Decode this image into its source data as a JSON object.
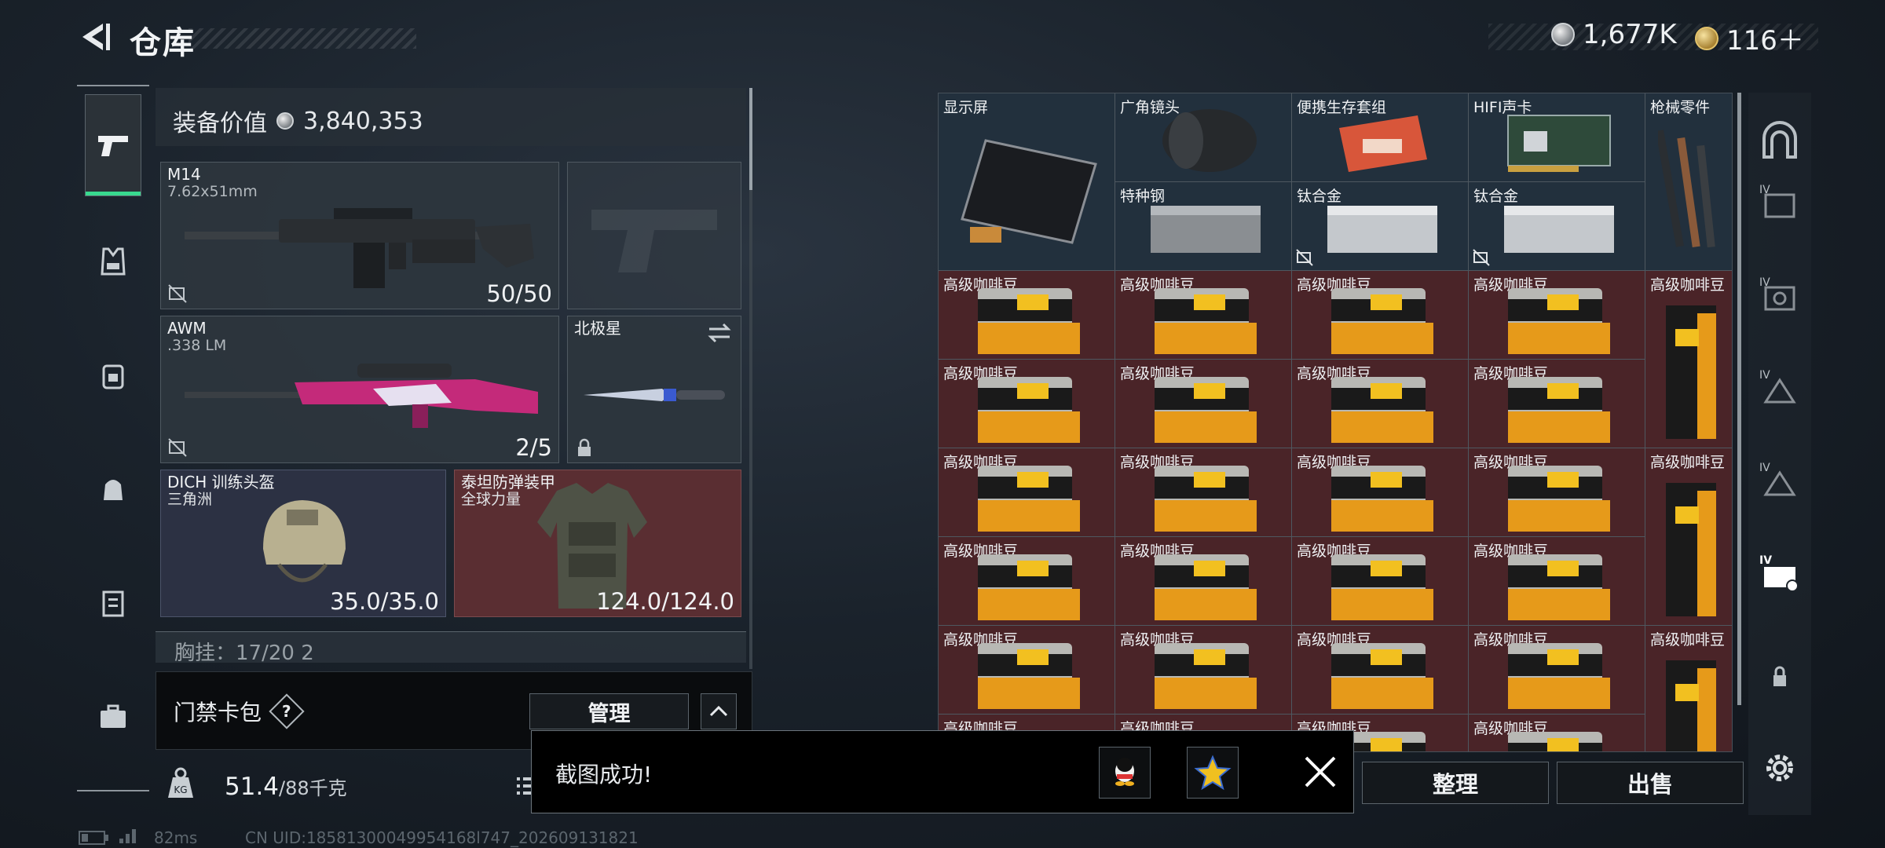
{
  "header": {
    "title": "仓库",
    "currency_silver": "1,677K",
    "currency_gold": "116＋"
  },
  "nav": [
    "weapons-icon",
    "vest-icon",
    "backpack-icon",
    "bag-icon",
    "clipboard-icon",
    "briefcase-icon"
  ],
  "equipment": {
    "value_label": "装备价值",
    "value": "3,840,353",
    "slots": {
      "primary1": {
        "name": "M14",
        "ammo": "7.62x51mm",
        "count": "50/50"
      },
      "primary2": {
        "name": "AWM",
        "ammo": ".338 LM",
        "count": "2/5"
      },
      "melee": {
        "name": "北极星"
      },
      "helmet": {
        "name": "DICH 训练头盔",
        "brand": "三角洲",
        "durability": "35.0/35.0"
      },
      "armor": {
        "name": "泰坦防弹装甲",
        "brand": "全球力量",
        "durability": "124.0/124.0"
      }
    },
    "chest_rig": "胸挂：17/20  2"
  },
  "keycard": {
    "label": "门禁卡包",
    "help": "?",
    "manage": "管理"
  },
  "weight": {
    "current": "51.4",
    "max": "/88千克"
  },
  "stash": {
    "top_items": {
      "display": "显示屏",
      "lens": "广角镜头",
      "survival": "便携生存套组",
      "soundcard": "HIFI声卡",
      "gunparts": "枪械零件",
      "steel": "特种钢",
      "titanium1": "钛合金",
      "titanium2": "钛合金"
    },
    "coffee": "高级咖啡豆"
  },
  "actions": {
    "sort": "整理",
    "sell": "出售"
  },
  "toast": {
    "message": "截图成功!"
  },
  "footer": {
    "ping": "82ms",
    "uid": "CN UID:18581300049954168l747_202609131821"
  },
  "colors": {
    "accent": "#38d98f",
    "red_cell": "#4a2428",
    "blue_cell": "#22303d"
  }
}
